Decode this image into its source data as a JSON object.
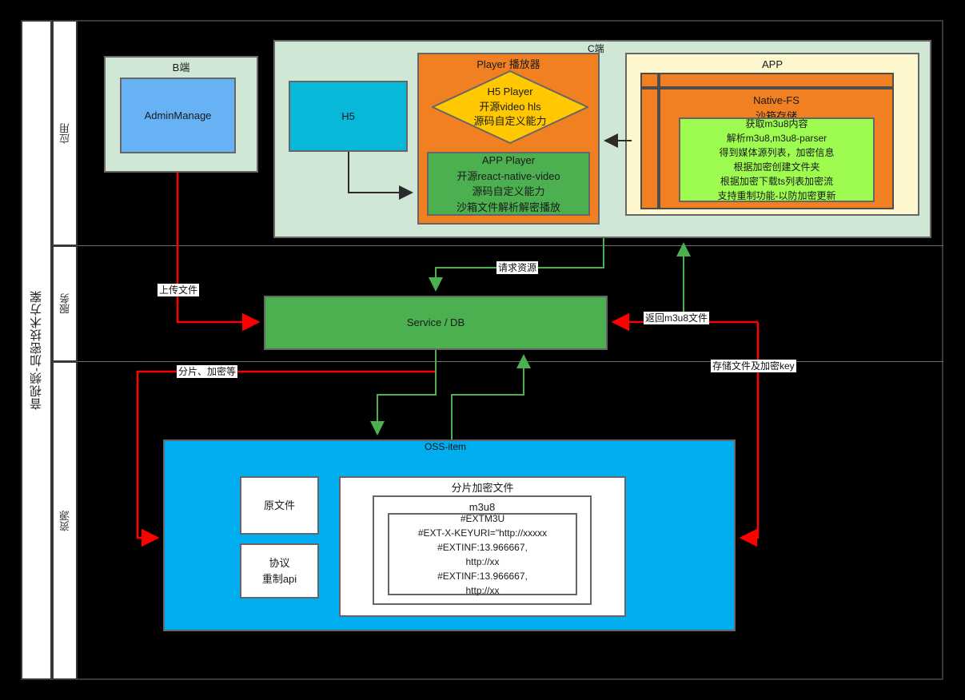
{
  "diagram": {
    "title": "音视频-加密技术方案",
    "lanes": [
      {
        "id": "app",
        "label": "应用"
      },
      {
        "id": "service",
        "label": "服务"
      },
      {
        "id": "resource",
        "label": "资源"
      }
    ]
  },
  "colors": {
    "pale_green": "#cfe7d4",
    "blue": "#66b2f5",
    "cyan": "#07b8d8",
    "orange": "#f08021",
    "pale_yellow": "#fdf7d0",
    "green": "#4caf50",
    "lime": "#9dfc4f",
    "gold": "#ffc800",
    "sky": "#00aeef",
    "red_edge": "#ff0000",
    "green_edge": "#4caf50",
    "black_edge": "#2b2b2b"
  },
  "nodes": {
    "b_side": {
      "label": "B端"
    },
    "admin_manage": {
      "label": "AdminManage"
    },
    "c_side": {
      "label": "C端"
    },
    "h5": {
      "label": "H5"
    },
    "player": {
      "label": "Player 播放器"
    },
    "h5_player": {
      "lines": [
        "H5 Player",
        "开源video hls",
        "源码自定义能力"
      ]
    },
    "app_player": {
      "lines": [
        "APP Player",
        "开源react-native-video",
        "源码自定义能力",
        "沙箱文件解析解密播放"
      ]
    },
    "app": {
      "label": "APP"
    },
    "native_fs": {
      "lines": [
        "Native-FS",
        "沙箱存储"
      ]
    },
    "native_fs_detail": {
      "lines": [
        "获取m3u8内容",
        "解析m3u8,m3u8-parser",
        "得到媒体源列表，加密信息",
        "根据加密创建文件夹",
        "根据加密下载ts列表加密流",
        "支持重制功能-以防加密更新"
      ]
    },
    "service_db": {
      "label": "Service / DB"
    },
    "oss_item": {
      "label": "OSS-item"
    },
    "raw_file": {
      "label": "原文件"
    },
    "protocol_api": {
      "lines": [
        "协议",
        "重制api"
      ]
    },
    "encrypted_chunk_file": {
      "label": "分片加密文件"
    },
    "m3u8": {
      "label": "m3u8"
    },
    "m3u8_content": {
      "lines": [
        "#EXTM3U",
        "#EXT-X-KEYURI=\"http://xxxxx",
        "#EXTINF:13.966667,",
        "http://xx",
        "#EXTINF:13.966667,",
        "http://xx"
      ]
    }
  },
  "edges": {
    "upload_file": {
      "label": "上传文件"
    },
    "request_resource": {
      "label": "请求资源"
    },
    "return_m3u8": {
      "label": "返回m3u8文件"
    },
    "split_encrypt": {
      "label": "分片、加密等"
    },
    "store_file_key": {
      "label": "存储文件及加密key"
    }
  }
}
